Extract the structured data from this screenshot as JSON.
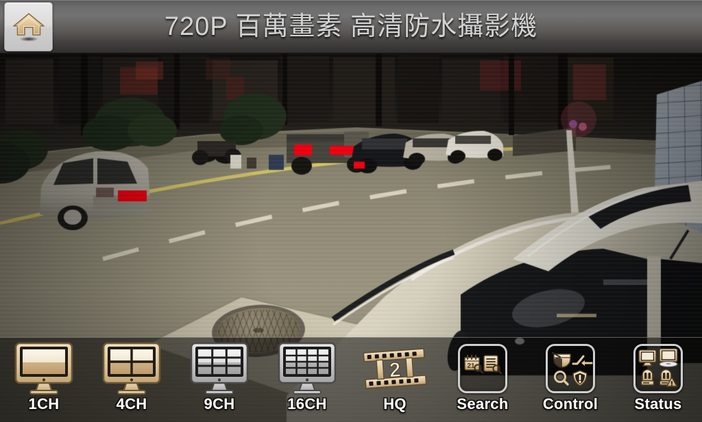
{
  "header": {
    "title": "720P 百萬畫素 高清防水攝影機",
    "home_button": {
      "label": "",
      "icon": "home-icon"
    }
  },
  "video": {
    "description": "Night-time street CCTV live view: parked silver hatchback at left, scooters and a small truck along the kerb, white and dark sedans parked further down the road, centre lane with dashed yellow markings, manhole cover on a concrete patch, large silver car hood and cabin filling the right foreground, tiled wall at far right.",
    "redactions": [
      "license-plate-left-car",
      "license-plate-truck-1",
      "license-plate-truck-2",
      "license-plate-dark-sedan"
    ],
    "colors": {
      "road": "#8d8874",
      "lane_marking": "#d8c964",
      "night_sky": "#1c1a17",
      "foreground_car": "#cfc9ba"
    }
  },
  "toolbar": {
    "items": [
      {
        "id": "1ch",
        "label": "1CH",
        "icon": "monitor-1ch-icon",
        "state": "active",
        "accent": "#e2c79a"
      },
      {
        "id": "4ch",
        "label": "4CH",
        "icon": "monitor-4ch-icon",
        "state": "active",
        "accent": "#e2c79a"
      },
      {
        "id": "9ch",
        "label": "9CH",
        "icon": "monitor-9ch-icon",
        "state": "inactive",
        "accent": "#b8b8b8"
      },
      {
        "id": "16ch",
        "label": "16CH",
        "icon": "monitor-16ch-icon",
        "state": "inactive",
        "accent": "#b8b8b8"
      },
      {
        "id": "hq",
        "label": "HQ",
        "icon": "filmstrip-icon",
        "state": "active",
        "accent": "#e2c79a",
        "badge": "2"
      },
      {
        "id": "search",
        "label": "Search",
        "icon": "search-group-icon",
        "state": "grouped",
        "accent": "#e2c79a"
      },
      {
        "id": "control",
        "label": "Control",
        "icon": "control-group-icon",
        "state": "grouped",
        "accent": "#e2c79a"
      },
      {
        "id": "status",
        "label": "Status",
        "icon": "status-group-icon",
        "state": "grouped",
        "accent": "#e2c79a"
      }
    ],
    "search_icons": [
      "calendar-search-icon",
      "log-list-search-icon"
    ],
    "control_icons": [
      "dome-camera-icon",
      "relay-switch-icon",
      "magnifier-icon",
      "alert-shield-icon"
    ],
    "status_icons": [
      "monitor-icon",
      "monitor-disk-icon",
      "device-icon",
      "device-alert-icon"
    ],
    "calendar_day": "21"
  }
}
